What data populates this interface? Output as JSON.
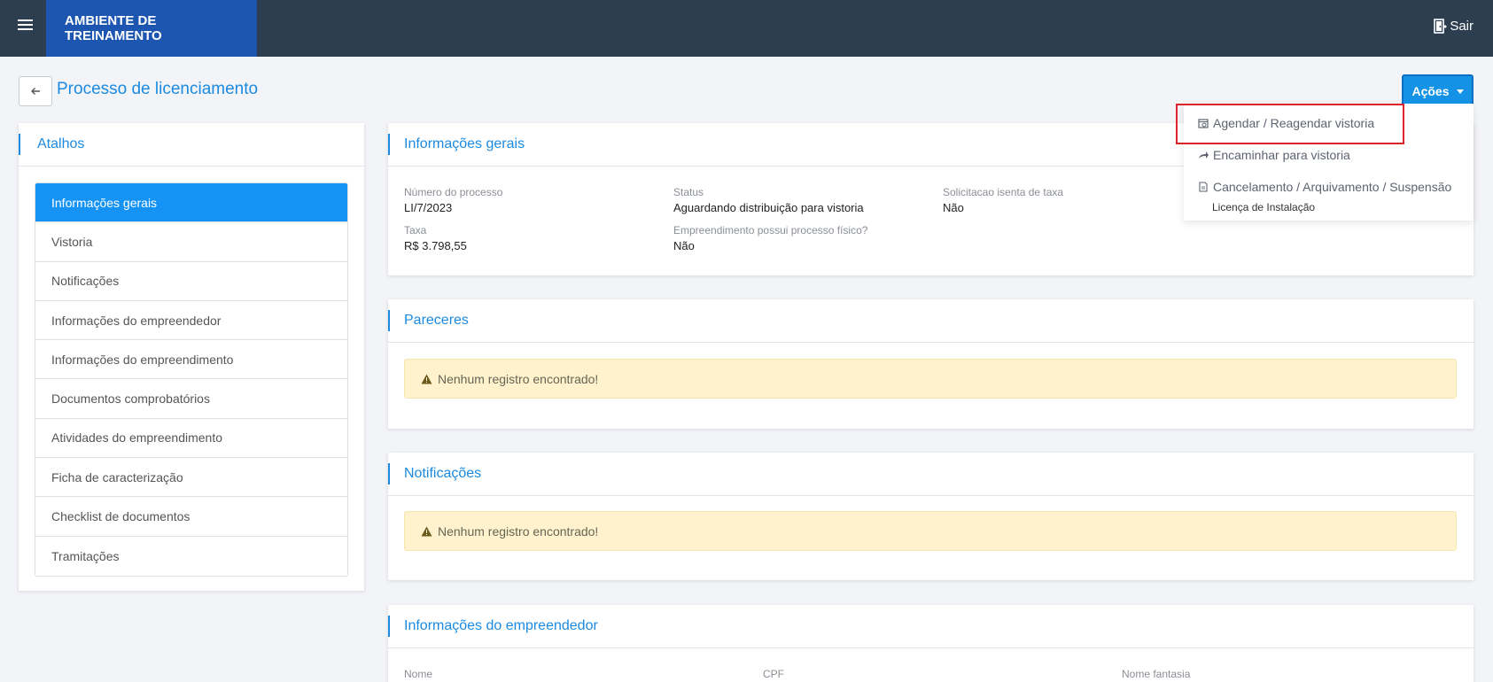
{
  "topbar": {
    "brand": "AMBIENTE DE TREINAMENTO",
    "logout_label": "Sair",
    "menu_icon": "hamburger-icon",
    "logout_icon": "door-exit-icon"
  },
  "page": {
    "title": "Processo de licenciamento",
    "back_icon": "arrow-left-icon",
    "actions_label": "Ações"
  },
  "sidebar": {
    "title": "Atalhos",
    "items": [
      {
        "label": "Informações gerais",
        "active": true
      },
      {
        "label": "Vistoria"
      },
      {
        "label": "Notificações"
      },
      {
        "label": "Informações do empreendedor"
      },
      {
        "label": "Informações do empreendimento"
      },
      {
        "label": "Documentos comprobatórios"
      },
      {
        "label": "Atividades do empreendimento"
      },
      {
        "label": "Ficha de caracterização"
      },
      {
        "label": "Checklist de documentos"
      },
      {
        "label": "Tramitações"
      }
    ]
  },
  "general_info": {
    "title": "Informações gerais",
    "fields": {
      "process_number": {
        "label": "Número do processo",
        "value": "LI/7/2023"
      },
      "status": {
        "label": "Status",
        "value": "Aguardando distribuição para vistoria"
      },
      "fee_exempt": {
        "label": "Solicitacao isenta de taxa",
        "value": "Não"
      },
      "fee": {
        "label": "Taxa",
        "value": "R$ 3.798,55"
      },
      "physical_process": {
        "label": "Empreendimento possui processo físico?",
        "value": "Não"
      }
    }
  },
  "opinions": {
    "title": "Pareceres",
    "empty_message": "Nenhum registro encontrado!"
  },
  "notifications": {
    "title": "Notificações",
    "empty_message": "Nenhum registro encontrado!"
  },
  "entrepreneur": {
    "title": "Informações do empreendedor",
    "columns": [
      "Nome",
      "CPF",
      "Nome fantasia"
    ]
  },
  "actions_menu": {
    "items": [
      {
        "label": "Agendar / Reagendar vistoria",
        "icon": "calendar-clock-icon"
      },
      {
        "label": "Encaminhar para vistoria",
        "icon": "forward-arrow-icon"
      },
      {
        "label": "Cancelamento / Arquivamento / Suspensão",
        "icon": "document-icon"
      }
    ],
    "license_type": "Licença de Instalação"
  },
  "colors": {
    "topbar": "#2c3e50",
    "brand": "#1c56b0",
    "accent": "#1b8ae0",
    "active_item": "#1493f5",
    "alert_bg": "#fff2cd",
    "highlight": "#e0222b"
  }
}
